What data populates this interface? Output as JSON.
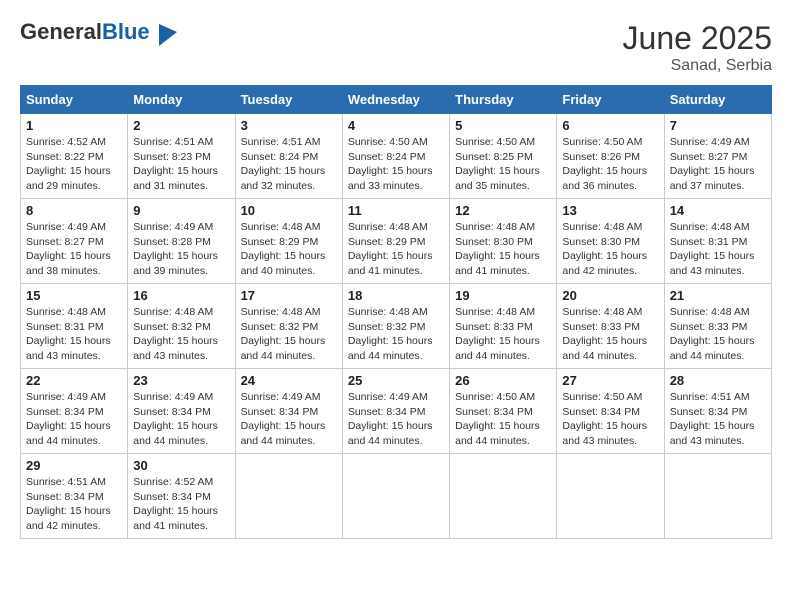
{
  "header": {
    "logo_general": "General",
    "logo_blue": "Blue",
    "title": "June 2025",
    "location": "Sanad, Serbia"
  },
  "columns": [
    "Sunday",
    "Monday",
    "Tuesday",
    "Wednesday",
    "Thursday",
    "Friday",
    "Saturday"
  ],
  "weeks": [
    [
      {
        "day": "1",
        "sunrise": "Sunrise: 4:52 AM",
        "sunset": "Sunset: 8:22 PM",
        "daylight": "Daylight: 15 hours and 29 minutes."
      },
      {
        "day": "2",
        "sunrise": "Sunrise: 4:51 AM",
        "sunset": "Sunset: 8:23 PM",
        "daylight": "Daylight: 15 hours and 31 minutes."
      },
      {
        "day": "3",
        "sunrise": "Sunrise: 4:51 AM",
        "sunset": "Sunset: 8:24 PM",
        "daylight": "Daylight: 15 hours and 32 minutes."
      },
      {
        "day": "4",
        "sunrise": "Sunrise: 4:50 AM",
        "sunset": "Sunset: 8:24 PM",
        "daylight": "Daylight: 15 hours and 33 minutes."
      },
      {
        "day": "5",
        "sunrise": "Sunrise: 4:50 AM",
        "sunset": "Sunset: 8:25 PM",
        "daylight": "Daylight: 15 hours and 35 minutes."
      },
      {
        "day": "6",
        "sunrise": "Sunrise: 4:50 AM",
        "sunset": "Sunset: 8:26 PM",
        "daylight": "Daylight: 15 hours and 36 minutes."
      },
      {
        "day": "7",
        "sunrise": "Sunrise: 4:49 AM",
        "sunset": "Sunset: 8:27 PM",
        "daylight": "Daylight: 15 hours and 37 minutes."
      }
    ],
    [
      {
        "day": "8",
        "sunrise": "Sunrise: 4:49 AM",
        "sunset": "Sunset: 8:27 PM",
        "daylight": "Daylight: 15 hours and 38 minutes."
      },
      {
        "day": "9",
        "sunrise": "Sunrise: 4:49 AM",
        "sunset": "Sunset: 8:28 PM",
        "daylight": "Daylight: 15 hours and 39 minutes."
      },
      {
        "day": "10",
        "sunrise": "Sunrise: 4:48 AM",
        "sunset": "Sunset: 8:29 PM",
        "daylight": "Daylight: 15 hours and 40 minutes."
      },
      {
        "day": "11",
        "sunrise": "Sunrise: 4:48 AM",
        "sunset": "Sunset: 8:29 PM",
        "daylight": "Daylight: 15 hours and 41 minutes."
      },
      {
        "day": "12",
        "sunrise": "Sunrise: 4:48 AM",
        "sunset": "Sunset: 8:30 PM",
        "daylight": "Daylight: 15 hours and 41 minutes."
      },
      {
        "day": "13",
        "sunrise": "Sunrise: 4:48 AM",
        "sunset": "Sunset: 8:30 PM",
        "daylight": "Daylight: 15 hours and 42 minutes."
      },
      {
        "day": "14",
        "sunrise": "Sunrise: 4:48 AM",
        "sunset": "Sunset: 8:31 PM",
        "daylight": "Daylight: 15 hours and 43 minutes."
      }
    ],
    [
      {
        "day": "15",
        "sunrise": "Sunrise: 4:48 AM",
        "sunset": "Sunset: 8:31 PM",
        "daylight": "Daylight: 15 hours and 43 minutes."
      },
      {
        "day": "16",
        "sunrise": "Sunrise: 4:48 AM",
        "sunset": "Sunset: 8:32 PM",
        "daylight": "Daylight: 15 hours and 43 minutes."
      },
      {
        "day": "17",
        "sunrise": "Sunrise: 4:48 AM",
        "sunset": "Sunset: 8:32 PM",
        "daylight": "Daylight: 15 hours and 44 minutes."
      },
      {
        "day": "18",
        "sunrise": "Sunrise: 4:48 AM",
        "sunset": "Sunset: 8:32 PM",
        "daylight": "Daylight: 15 hours and 44 minutes."
      },
      {
        "day": "19",
        "sunrise": "Sunrise: 4:48 AM",
        "sunset": "Sunset: 8:33 PM",
        "daylight": "Daylight: 15 hours and 44 minutes."
      },
      {
        "day": "20",
        "sunrise": "Sunrise: 4:48 AM",
        "sunset": "Sunset: 8:33 PM",
        "daylight": "Daylight: 15 hours and 44 minutes."
      },
      {
        "day": "21",
        "sunrise": "Sunrise: 4:48 AM",
        "sunset": "Sunset: 8:33 PM",
        "daylight": "Daylight: 15 hours and 44 minutes."
      }
    ],
    [
      {
        "day": "22",
        "sunrise": "Sunrise: 4:49 AM",
        "sunset": "Sunset: 8:34 PM",
        "daylight": "Daylight: 15 hours and 44 minutes."
      },
      {
        "day": "23",
        "sunrise": "Sunrise: 4:49 AM",
        "sunset": "Sunset: 8:34 PM",
        "daylight": "Daylight: 15 hours and 44 minutes."
      },
      {
        "day": "24",
        "sunrise": "Sunrise: 4:49 AM",
        "sunset": "Sunset: 8:34 PM",
        "daylight": "Daylight: 15 hours and 44 minutes."
      },
      {
        "day": "25",
        "sunrise": "Sunrise: 4:49 AM",
        "sunset": "Sunset: 8:34 PM",
        "daylight": "Daylight: 15 hours and 44 minutes."
      },
      {
        "day": "26",
        "sunrise": "Sunrise: 4:50 AM",
        "sunset": "Sunset: 8:34 PM",
        "daylight": "Daylight: 15 hours and 44 minutes."
      },
      {
        "day": "27",
        "sunrise": "Sunrise: 4:50 AM",
        "sunset": "Sunset: 8:34 PM",
        "daylight": "Daylight: 15 hours and 43 minutes."
      },
      {
        "day": "28",
        "sunrise": "Sunrise: 4:51 AM",
        "sunset": "Sunset: 8:34 PM",
        "daylight": "Daylight: 15 hours and 43 minutes."
      }
    ],
    [
      {
        "day": "29",
        "sunrise": "Sunrise: 4:51 AM",
        "sunset": "Sunset: 8:34 PM",
        "daylight": "Daylight: 15 hours and 42 minutes."
      },
      {
        "day": "30",
        "sunrise": "Sunrise: 4:52 AM",
        "sunset": "Sunset: 8:34 PM",
        "daylight": "Daylight: 15 hours and 41 minutes."
      },
      null,
      null,
      null,
      null,
      null
    ]
  ]
}
